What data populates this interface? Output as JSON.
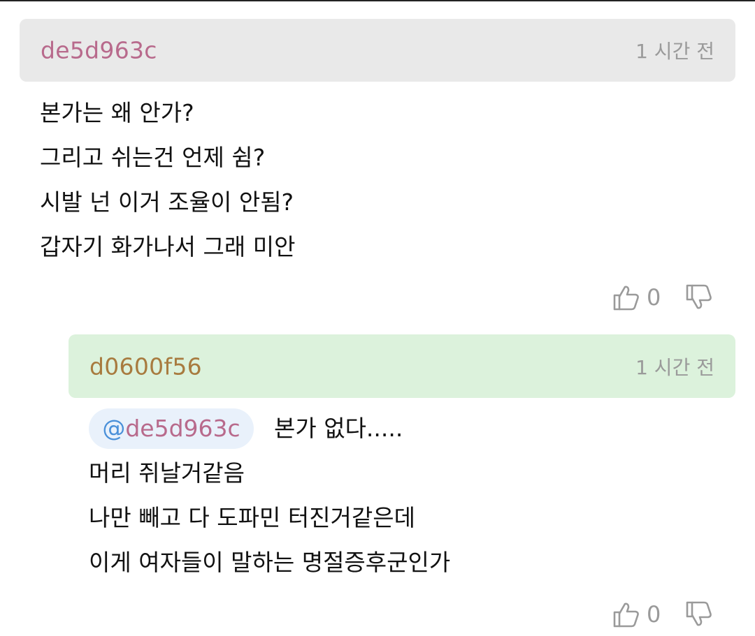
{
  "comments": [
    {
      "author": "de5d963c",
      "time": "1 시간 전",
      "lines": [
        "본가는 왜 안가?",
        "그리고 쉬는건 언제 쉼?",
        "시발 넌 이거 조율이 안됨?",
        "갑자기 화가나서 그래 미안"
      ],
      "likes": "0",
      "header_color": "#e9e9e9",
      "author_color": "#b86a8c"
    },
    {
      "author": "d0600f56",
      "time": "1 시간 전",
      "mention_at": "@",
      "mention_name": "de5d963c",
      "lines": [
        "본가 없다.....",
        "머리 쥐날거같음",
        "나만 빼고 다 도파민 터진거같은데",
        "이게 여자들이 말하는 명절증후군인가"
      ],
      "likes": "0",
      "header_color": "#dcf2dc",
      "author_color": "#a87b3f"
    }
  ],
  "icons": {
    "like": "thumbs-up-icon",
    "dislike": "thumbs-down-icon"
  }
}
